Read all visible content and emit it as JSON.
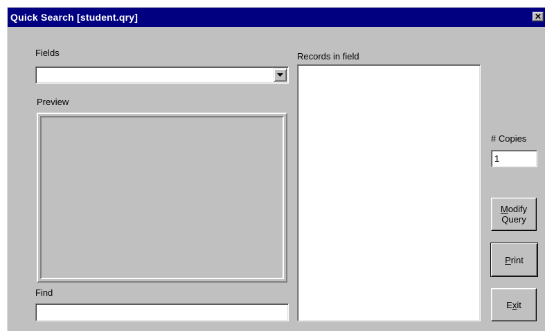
{
  "window": {
    "title": "Quick Search [student.qry]",
    "close_glyph": "✕"
  },
  "fields": {
    "label": "Fields",
    "selected_value": ""
  },
  "preview": {
    "label": "Preview"
  },
  "find": {
    "label": "Find",
    "value": ""
  },
  "records": {
    "label": "Records in field",
    "items": []
  },
  "copies": {
    "label": "# Copies",
    "value": "1"
  },
  "buttons": {
    "modify_line1_mnemonic": "M",
    "modify_line1_rest": "odify",
    "modify_line2": "Query",
    "print_mnemonic": "P",
    "print_rest": "rint",
    "exit_first": "E",
    "exit_mnemonic": "x",
    "exit_rest": "it"
  },
  "colors": {
    "titlebar": "#000080",
    "face": "#c0c0c0"
  }
}
